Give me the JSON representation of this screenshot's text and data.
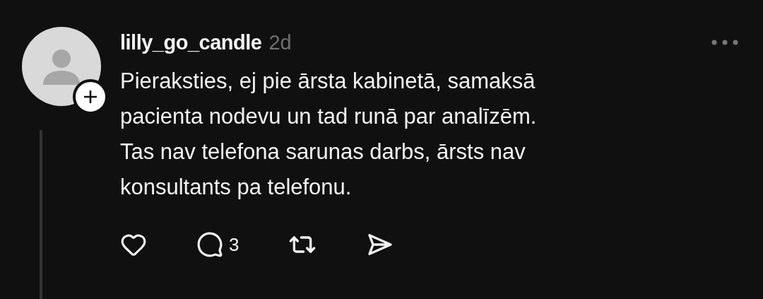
{
  "post": {
    "username": "lilly_go_candle",
    "time": "2d",
    "body_lines": [
      "Pieraksties, ej pie ārsta kabinetā, samaksā",
      "pacienta nodevu un tad runā par analīzēm.",
      "Tas nav telefona sarunas darbs, ārsts nav",
      "konsultants pa telefonu."
    ],
    "actions": [
      {
        "kind": "like"
      },
      {
        "kind": "reply",
        "count": "3"
      },
      {
        "kind": "repost"
      },
      {
        "kind": "share"
      }
    ]
  }
}
